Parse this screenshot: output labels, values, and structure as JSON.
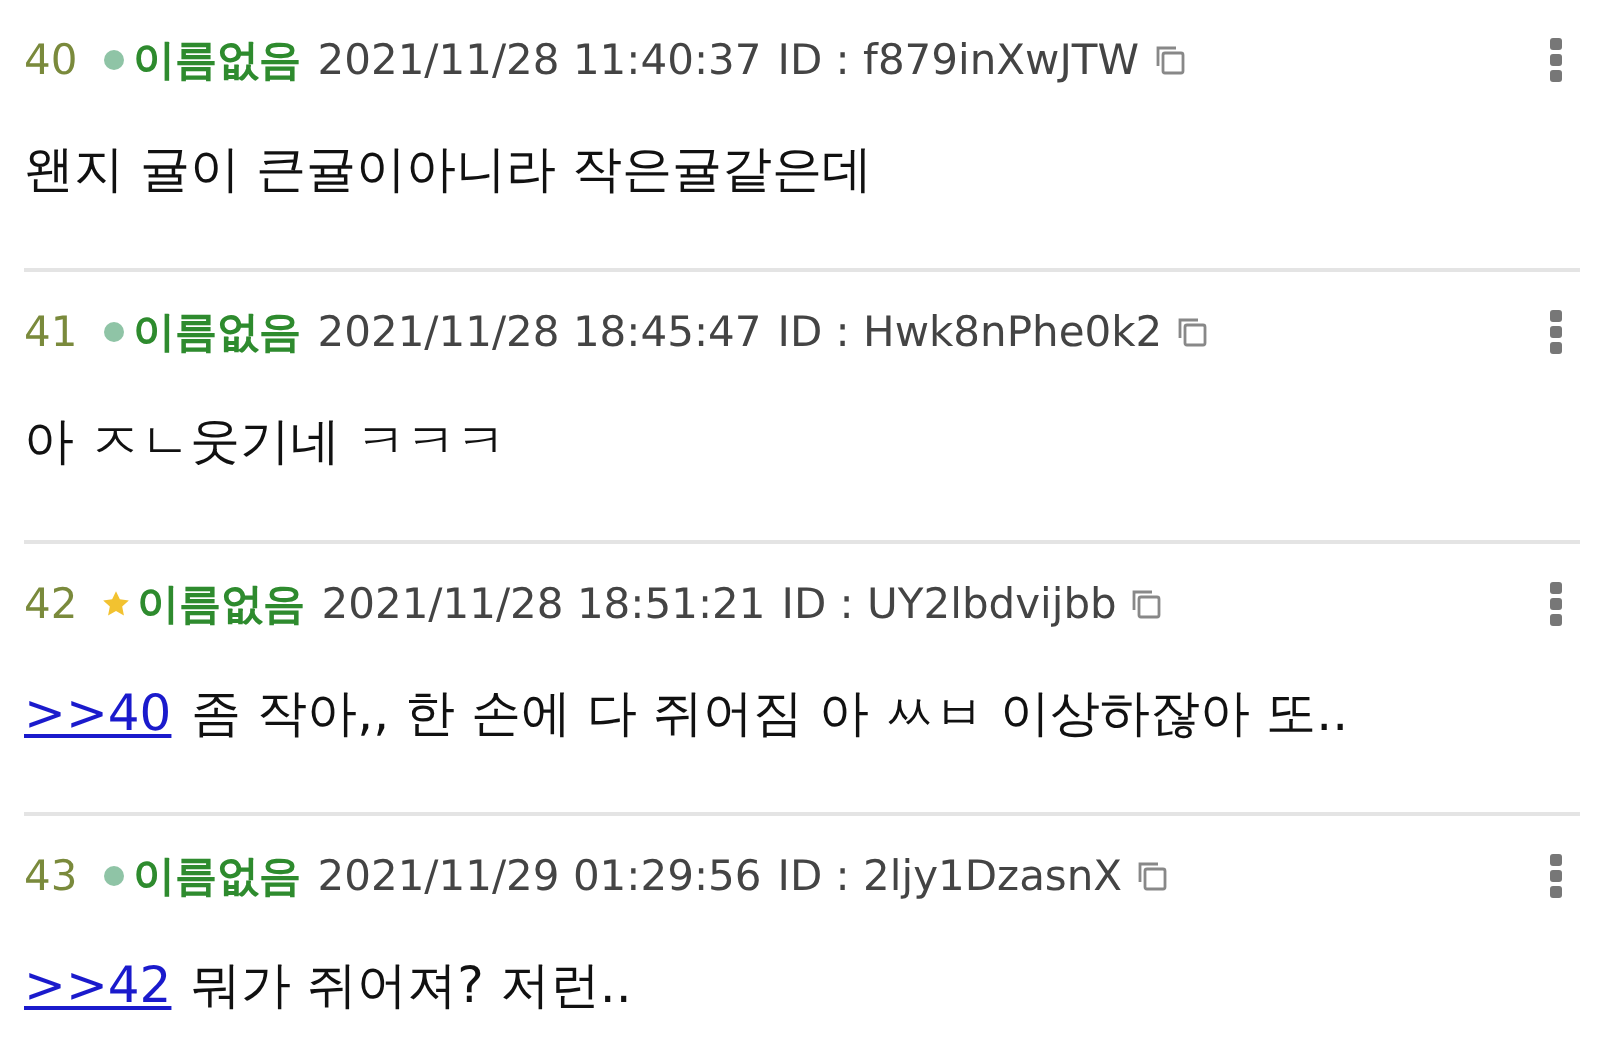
{
  "posts": [
    {
      "number": "40",
      "kind": "dot",
      "name": "이름없음",
      "datetime": "2021/11/28 11:40:37",
      "id": "ID : f879inXwJTW",
      "body": "왠지 귤이 큰귤이아니라 작은귤같은데"
    },
    {
      "number": "41",
      "kind": "dot",
      "name": "이름없음",
      "datetime": "2021/11/28 18:45:47",
      "id": "ID : Hwk8nPhe0k2",
      "body": "아 ㅈㄴ웃기네 ㅋㅋㅋ"
    },
    {
      "number": "42",
      "kind": "star",
      "name": "이름없음",
      "datetime": "2021/11/28 18:51:21",
      "id": "ID : UY2lbdvijbb",
      "reply_to": ">>40",
      "body": "좀 작아,, 한 손에 다 쥐어짐 아 ㅆㅂ 이상하잖아 또.."
    },
    {
      "number": "43",
      "kind": "dot",
      "name": "이름없음",
      "datetime": "2021/11/29 01:29:56",
      "id": "ID : 2ljy1DzasnX",
      "reply_to": ">>42",
      "body": "뭐가 쥐어져? 저런.."
    }
  ]
}
